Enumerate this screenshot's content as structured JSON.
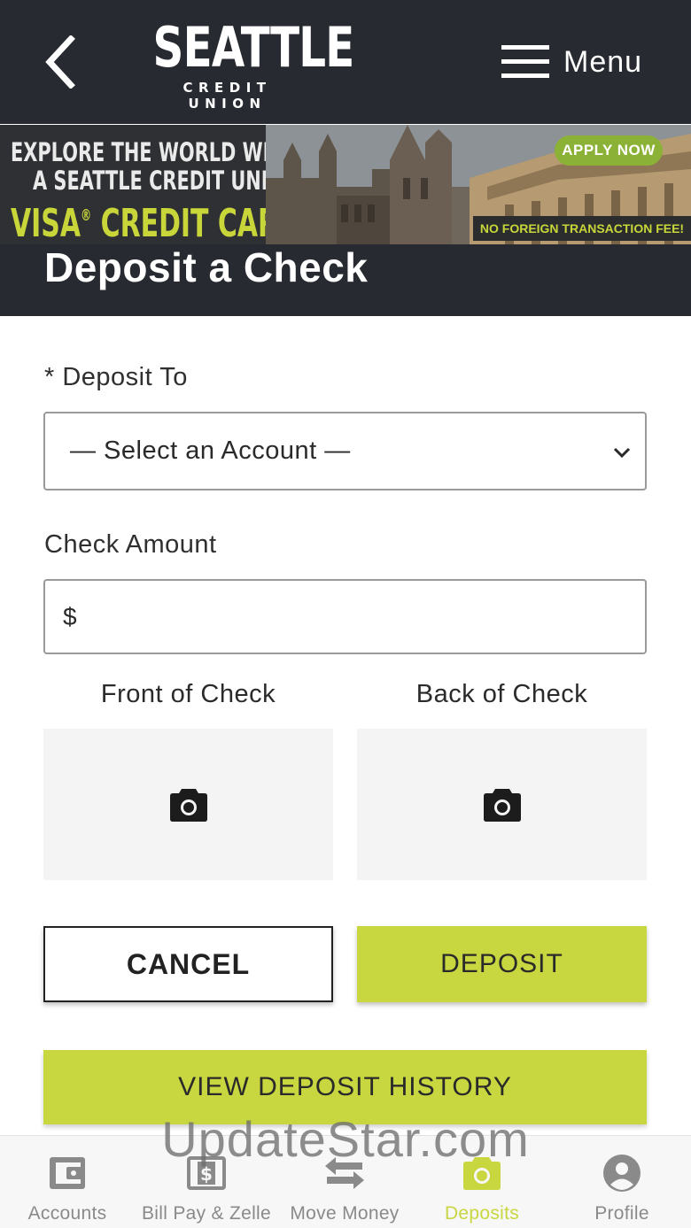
{
  "header": {
    "logo_main": "SEATTLE",
    "logo_sub": "CREDIT UNION",
    "menu_label": "Menu"
  },
  "banner": {
    "line1": "EXPLORE THE WORLD WITH",
    "line2": "A SEATTLE CREDIT UNION",
    "line3": "VISA",
    "line3_mark": "®",
    "line3_rest": " CREDIT CARD",
    "apply": "APPLY NOW",
    "fee": "NO FOREIGN TRANSACTION FEE!"
  },
  "page": {
    "title": "Deposit a Check"
  },
  "form": {
    "deposit_to_label": "* Deposit To",
    "account_select_value": "— Select an Account —",
    "amount_label": "Check Amount",
    "amount_prefix": "$",
    "amount_value": "",
    "front_label": "Front of Check",
    "back_label": "Back of Check"
  },
  "buttons": {
    "cancel": "CANCEL",
    "deposit": "DEPOSIT",
    "history": "VIEW DEPOSIT HISTORY"
  },
  "tabs": [
    {
      "label": "Accounts",
      "icon": "wallet-icon",
      "active": false
    },
    {
      "label": "Bill Pay & Zelle",
      "icon": "bill-icon",
      "active": false
    },
    {
      "label": "Move Money",
      "icon": "transfer-arrows-icon",
      "active": false
    },
    {
      "label": "Deposits",
      "icon": "camera-icon",
      "active": true
    },
    {
      "label": "Profile",
      "icon": "person-icon",
      "active": false
    }
  ],
  "watermark": "UpdateStar.com",
  "colors": {
    "header_bg": "#272a30",
    "accent": "#c8d63f",
    "tab_inactive": "#8a8a8a"
  }
}
